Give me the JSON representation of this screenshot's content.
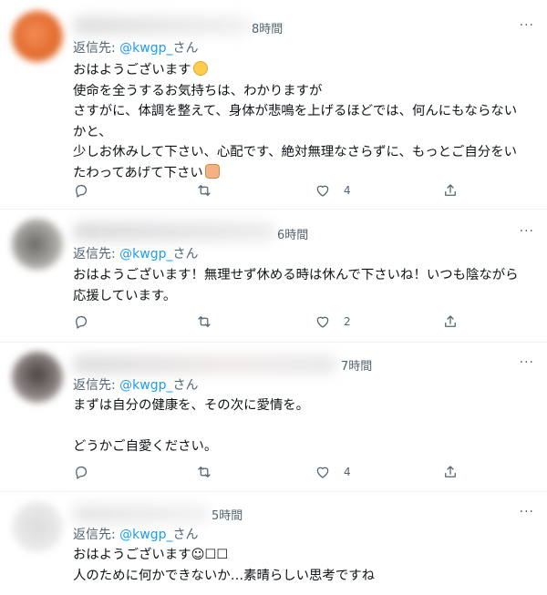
{
  "tweets": [
    {
      "time": "8時間",
      "more": "···",
      "reply_prefix": "返信先: ",
      "reply_handle": "@kwgp_",
      "reply_suffix": "さん",
      "body": "おはようございます",
      "body2": "\n使命を全うするお気持ちは、わかりますが\nさすがに、体調を整えて、身体が悲鳴を上げるほどでは、何んにもならないかと、\n少しお休みして下さい、心配です、絶対無理なさらずに、もっとご自分をいたわってあげて下さい",
      "likes": "4",
      "avatar_color": "#e8733a"
    },
    {
      "time": "6時間",
      "more": "···",
      "reply_prefix": "返信先: ",
      "reply_handle": "@kwgp_",
      "reply_suffix": "さん",
      "body": "おはようございます！無理せず休める時は休んで下さいね！いつも陰ながら応援しています。",
      "likes": "2",
      "avatar_color": "#8a8884"
    },
    {
      "time": "7時間",
      "more": "···",
      "reply_prefix": "返信先: ",
      "reply_handle": "@kwgp_",
      "reply_suffix": "さん",
      "body": "まずは自分の健康を、その次に愛情を。\n\nどうかご自愛ください。",
      "likes": "4",
      "avatar_color": "#6e6664"
    },
    {
      "time": "5時間",
      "more": "···",
      "reply_prefix": "返信先: ",
      "reply_handle": "@kwgp_",
      "reply_suffix": "さん",
      "body": "おはようございます☺︎☐☐\n人のために何かできないか…素晴らしい思考ですね",
      "avatar_color": "#e4e4e4"
    }
  ]
}
